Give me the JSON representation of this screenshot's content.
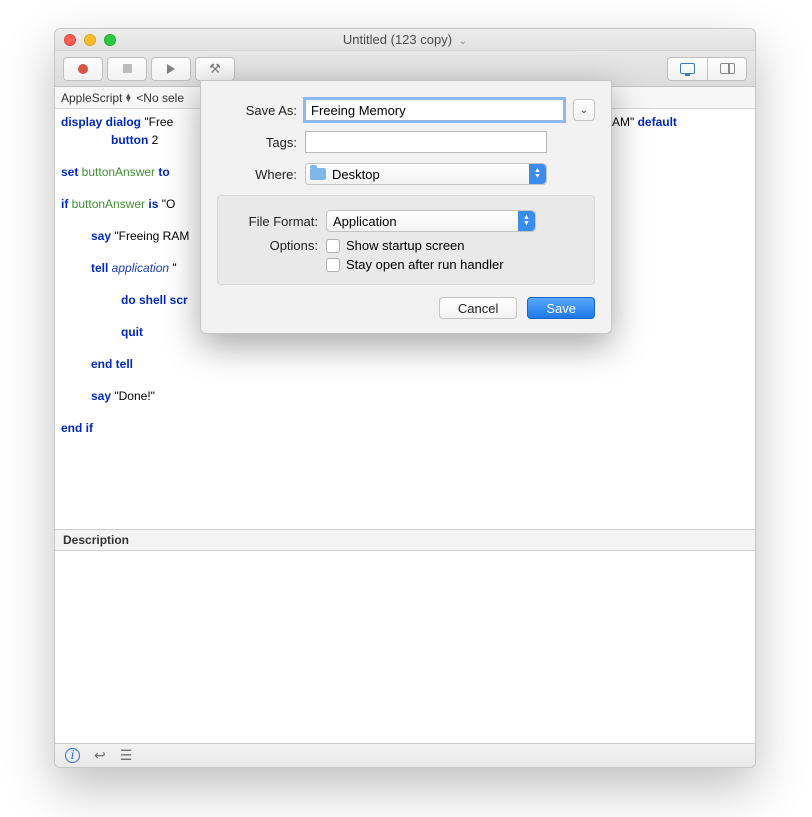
{
  "title": "Untitled (123 copy)",
  "secondary": {
    "language": "AppleScript",
    "selection": "<No sele"
  },
  "code": {
    "l1_kw1": "display dialog",
    "l1_str": " \"Free",
    "l1_tail": "g RAM\" ",
    "l1_kw2": "default",
    "l2_kw": "button",
    "l2_num": " 2",
    "l3_kw": "set",
    "l3_var": " buttonAnswer",
    "l3_kw2": " to ",
    "l4_kw": "if",
    "l4_var": " buttonAnswer",
    "l4_kw2": " is ",
    "l4_str": "\"O",
    "l5_kw": "say",
    "l5_str": " \"Freeing RAM",
    "l6_kw": "tell",
    "l6_app": " application",
    "l6_str": " \"",
    "l7_kw": "do shell scr",
    "l8_kw": "quit",
    "l9_kw": "end tell",
    "l10_kw": "say",
    "l10_str": " \"Done!\"",
    "l11_kw": "end if"
  },
  "description_header": "Description",
  "dialog": {
    "save_as_label": "Save As:",
    "save_as_value": "Freeing Memory",
    "tags_label": "Tags:",
    "tags_value": "",
    "where_label": "Where:",
    "where_value": "Desktop",
    "format_label": "File Format:",
    "format_value": "Application",
    "options_label": "Options:",
    "opt1": "Show startup screen",
    "opt2": "Stay open after run handler",
    "cancel": "Cancel",
    "save": "Save"
  }
}
